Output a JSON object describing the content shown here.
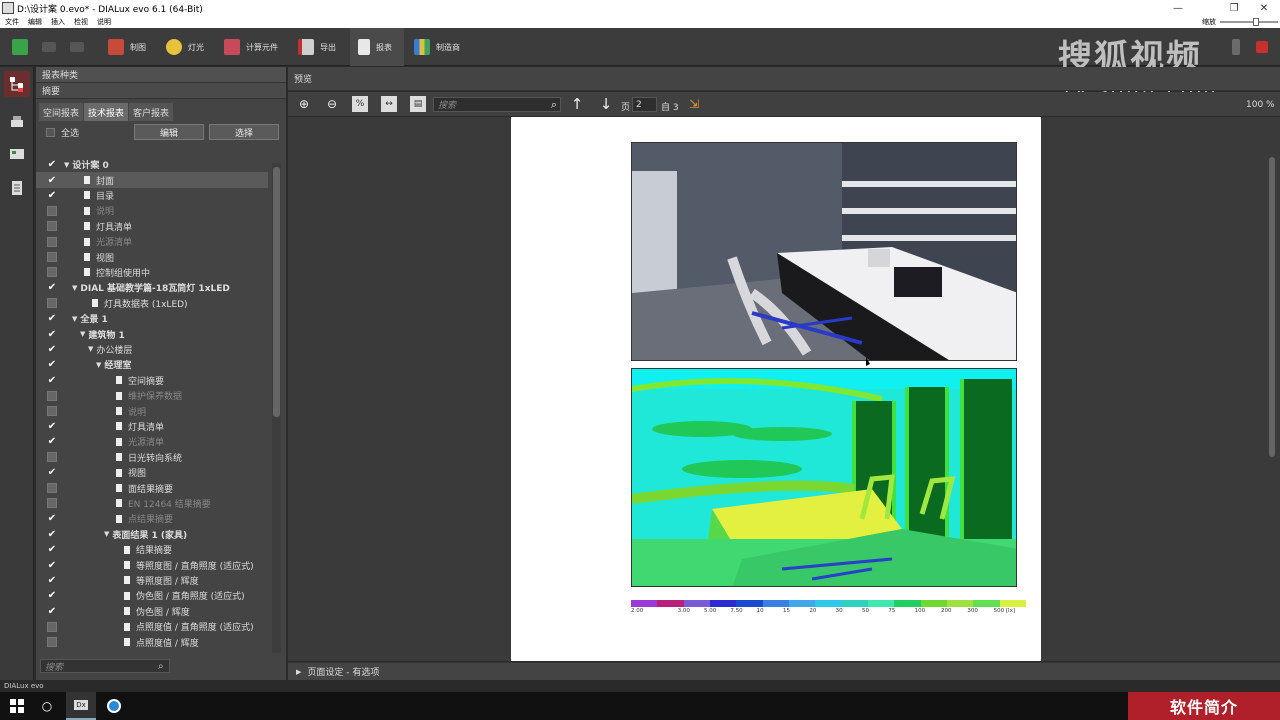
{
  "window": {
    "title": "D:\\设计案 0.evo* - DIALux evo 6.1  (64-Bit)",
    "minimize": "—",
    "maximize": "❐",
    "close": "✕"
  },
  "menu": {
    "items": [
      "文件",
      "编辑",
      "插入",
      "检视",
      "说明"
    ],
    "zoom_label": "缩放"
  },
  "toolbar": {
    "items": [
      "制图",
      "灯光",
      "计算元件",
      "导出",
      "报表",
      "制造商"
    ],
    "active": "报表"
  },
  "watermark": {
    "line1": "搜狐视频",
    "line2": "tv.sohu.com"
  },
  "panel": {
    "header": "报表种类",
    "section": "摘要",
    "tabs": [
      "空间报表",
      "技术报表",
      "客户报表"
    ],
    "select_all": "全选",
    "edit_button": "编辑",
    "select_button": "选择",
    "search_placeholder": "搜索",
    "tree": [
      {
        "label": "设计案 0",
        "checked": true,
        "level": 0,
        "arrow": true,
        "doc": false,
        "bold": true,
        "dim": false
      },
      {
        "label": "封面",
        "checked": true,
        "level": 1,
        "arrow": false,
        "doc": true,
        "bold": false,
        "dim": false,
        "selected": true
      },
      {
        "label": "目录",
        "checked": true,
        "level": 1,
        "arrow": false,
        "doc": true,
        "bold": false,
        "dim": false
      },
      {
        "label": "说明",
        "checked": false,
        "level": 1,
        "arrow": false,
        "doc": true,
        "bold": false,
        "dim": true
      },
      {
        "label": "灯具清单",
        "checked": false,
        "level": 1,
        "arrow": false,
        "doc": true,
        "bold": false,
        "dim": false
      },
      {
        "label": "光源清单",
        "checked": false,
        "level": 1,
        "arrow": false,
        "doc": true,
        "bold": false,
        "dim": true
      },
      {
        "label": "视图",
        "checked": false,
        "level": 1,
        "arrow": false,
        "doc": true,
        "bold": false,
        "dim": false
      },
      {
        "label": "控制组使用中",
        "checked": false,
        "level": 1,
        "arrow": false,
        "doc": true,
        "bold": false,
        "dim": false
      },
      {
        "label": "DIAL 基础教学篇-18瓦筒灯 1xLED",
        "checked": true,
        "level": 1,
        "arrow": true,
        "doc": false,
        "bold": true,
        "dim": false
      },
      {
        "label": "灯具数据表 (1xLED)",
        "checked": false,
        "level": 2,
        "arrow": false,
        "doc": true,
        "bold": false,
        "dim": false
      },
      {
        "label": "全景 1",
        "checked": true,
        "level": 1,
        "arrow": true,
        "doc": false,
        "bold": true,
        "dim": false
      },
      {
        "label": "建筑物 1",
        "checked": true,
        "level": 2,
        "arrow": true,
        "doc": false,
        "bold": true,
        "dim": false
      },
      {
        "label": "办公楼层",
        "checked": true,
        "level": 3,
        "arrow": true,
        "doc": false,
        "bold": false,
        "dim": false
      },
      {
        "label": "经理室",
        "checked": true,
        "level": 4,
        "arrow": true,
        "doc": false,
        "bold": true,
        "dim": false
      },
      {
        "label": "空间摘要",
        "checked": true,
        "level": 5,
        "arrow": false,
        "doc": true,
        "bold": false,
        "dim": false
      },
      {
        "label": "维护保养数据",
        "checked": false,
        "level": 5,
        "arrow": false,
        "doc": true,
        "bold": false,
        "dim": true
      },
      {
        "label": "说明",
        "checked": false,
        "level": 5,
        "arrow": false,
        "doc": true,
        "bold": false,
        "dim": true
      },
      {
        "label": "灯具清单",
        "checked": true,
        "level": 5,
        "arrow": false,
        "doc": true,
        "bold": false,
        "dim": false
      },
      {
        "label": "光源清单",
        "checked": true,
        "level": 5,
        "arrow": false,
        "doc": true,
        "bold": false,
        "dim": true
      },
      {
        "label": "日光转向系统",
        "checked": false,
        "level": 5,
        "arrow": false,
        "doc": true,
        "bold": false,
        "dim": false
      },
      {
        "label": "视图",
        "checked": true,
        "level": 5,
        "arrow": false,
        "doc": true,
        "bold": false,
        "dim": false
      },
      {
        "label": "面结果摘要",
        "checked": false,
        "level": 5,
        "arrow": false,
        "doc": true,
        "bold": false,
        "dim": false
      },
      {
        "label": "EN 12464 结果摘要",
        "checked": false,
        "level": 5,
        "arrow": false,
        "doc": true,
        "bold": false,
        "dim": true
      },
      {
        "label": "点结果摘要",
        "checked": true,
        "level": 5,
        "arrow": false,
        "doc": true,
        "bold": false,
        "dim": true
      },
      {
        "label": "表面结果 1 (家具)",
        "checked": true,
        "level": 5,
        "arrow": true,
        "doc": false,
        "bold": true,
        "dim": false
      },
      {
        "label": "结果摘要",
        "checked": true,
        "level": 6,
        "arrow": false,
        "doc": true,
        "bold": false,
        "dim": false
      },
      {
        "label": "等照度图 / 直角照度 (适应式)",
        "checked": true,
        "level": 6,
        "arrow": false,
        "doc": true,
        "bold": false,
        "dim": false
      },
      {
        "label": "等照度图 / 辉度",
        "checked": true,
        "level": 6,
        "arrow": false,
        "doc": true,
        "bold": false,
        "dim": false
      },
      {
        "label": "伪色图 / 直角照度 (适应式)",
        "checked": true,
        "level": 6,
        "arrow": false,
        "doc": true,
        "bold": false,
        "dim": false
      },
      {
        "label": "伪色图 / 辉度",
        "checked": true,
        "level": 6,
        "arrow": false,
        "doc": true,
        "bold": false,
        "dim": false
      },
      {
        "label": "点照度值 / 直角照度 (适应式)",
        "checked": false,
        "level": 6,
        "arrow": false,
        "doc": true,
        "bold": false,
        "dim": false
      },
      {
        "label": "点照度值 / 辉度",
        "checked": false,
        "level": 6,
        "arrow": false,
        "doc": true,
        "bold": false,
        "dim": false
      }
    ]
  },
  "preview": {
    "header": "预览",
    "search_placeholder": "搜索",
    "page_label": "页",
    "page_value": "2",
    "of_label": "自 3",
    "zoom": "100 %",
    "legend_values": [
      "2.00",
      "3.00",
      "5.00",
      "7.50",
      "10",
      "15",
      "20",
      "30",
      "50",
      "75",
      "100",
      "200",
      "300",
      "500 [lx]"
    ],
    "legend_colors": [
      "#9b3bd6",
      "#b81f7a",
      "#7a5ad6",
      "#2a2ad0",
      "#1a4ad0",
      "#3a80e0",
      "#40a8e8",
      "#30c8e8",
      "#30d0c0",
      "#40e8b0",
      "#20d060",
      "#70d830",
      "#a0e040",
      "#60e050",
      "#d8f040"
    ]
  },
  "page_setup": "页面设定 - 有选项",
  "statusbar": "DIALux evo",
  "taskbar": {
    "brand": "软件简介"
  }
}
